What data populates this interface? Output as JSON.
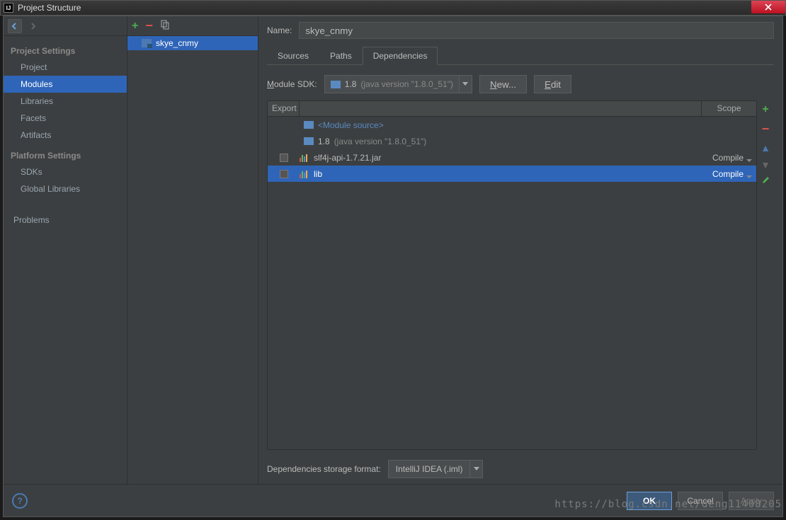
{
  "window": {
    "title": "Project Structure"
  },
  "leftnav": {
    "section1_title": "Project Settings",
    "items1": [
      "Project",
      "Modules",
      "Libraries",
      "Facets",
      "Artifacts"
    ],
    "selected1": "Modules",
    "section2_title": "Platform Settings",
    "items2": [
      "SDKs",
      "Global Libraries"
    ],
    "section3_item": "Problems"
  },
  "tree": {
    "module_name": "skye_cnmy"
  },
  "right": {
    "name_label": "Name:",
    "name_value": "skye_cnmy",
    "tabs": [
      "Sources",
      "Paths",
      "Dependencies"
    ],
    "active_tab": "Dependencies",
    "module_sdk_label_pre": "M",
    "module_sdk_label_post": "odule SDK:",
    "sdk_name": "1.8",
    "sdk_detail": "(java version \"1.8.0_51\")",
    "new_btn_pre": "N",
    "new_btn_post": "ew...",
    "edit_btn_pre": "E",
    "edit_btn_post": "dit",
    "col_export": "Export",
    "col_scope": "Scope",
    "rows": [
      {
        "type": "source",
        "label": "<Module source>",
        "scope": "",
        "checkbox": false
      },
      {
        "type": "sdk",
        "label": "1.8",
        "detail": "(java version \"1.8.0_51\")",
        "scope": "",
        "checkbox": false
      },
      {
        "type": "jar",
        "label": "slf4j-api-1.7.21.jar",
        "scope": "Compile",
        "checkbox": true
      },
      {
        "type": "lib",
        "label": "lib",
        "scope": "Compile",
        "checkbox": true,
        "selected": true
      }
    ],
    "storage_label": "Dependencies storage format:",
    "storage_value": "IntelliJ IDEA (.iml)"
  },
  "footer": {
    "ok": "OK",
    "cancel": "Cancel",
    "apply": "Apply"
  },
  "watermark": "https://blog.csdn.net/deng11408205"
}
